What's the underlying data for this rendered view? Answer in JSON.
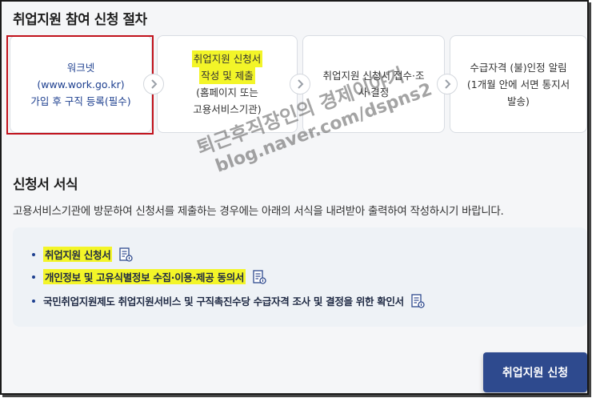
{
  "steps_section": {
    "title": "취업지원 참여 신청 절차",
    "steps": [
      {
        "lines": [
          "워크넷",
          "(www.work.go.kr)",
          "가입 후 구직 등록(필수)"
        ]
      },
      {
        "lines": [
          "취업지원 신청서",
          "작성 및 제출",
          "(홈페이지 또는",
          "고용서비스기관)"
        ]
      },
      {
        "lines": [
          "취업지원 신청서 접수·조",
          "사·결정"
        ]
      },
      {
        "lines": [
          "수급자격 (불)인정 알림",
          "(1개월 안에 서면 통지서",
          "발송)"
        ]
      }
    ]
  },
  "forms_section": {
    "title": "신청서 서식",
    "description": "고용서비스기관에 방문하여 신청서를 제출하는 경우에는 아래의 서식을 내려받아 출력하여 작성하시기 바랍니다.",
    "items": [
      {
        "label": "취업지원 신청서",
        "icon": "document-download-icon"
      },
      {
        "label": "개인정보 및 고유식별정보 수집·이용·제공 동의서",
        "icon": "document-download-icon"
      },
      {
        "label": "국민취업지원제도 취업지원서비스 및 구직촉진수당 수급자격 조사 및 결정을 위한 확인서",
        "icon": "document-download-icon"
      }
    ]
  },
  "apply_button": {
    "label": "취업지원 신청"
  },
  "watermark": {
    "line1": "퇴근후직장인의 경제이야기",
    "line2": "blog.naver.com/dspns2"
  },
  "colors": {
    "accent": "#2e4a8e",
    "highlight": "#f3f528",
    "annotation_box": "#c1121c",
    "step1_text": "#1d3f8f"
  }
}
